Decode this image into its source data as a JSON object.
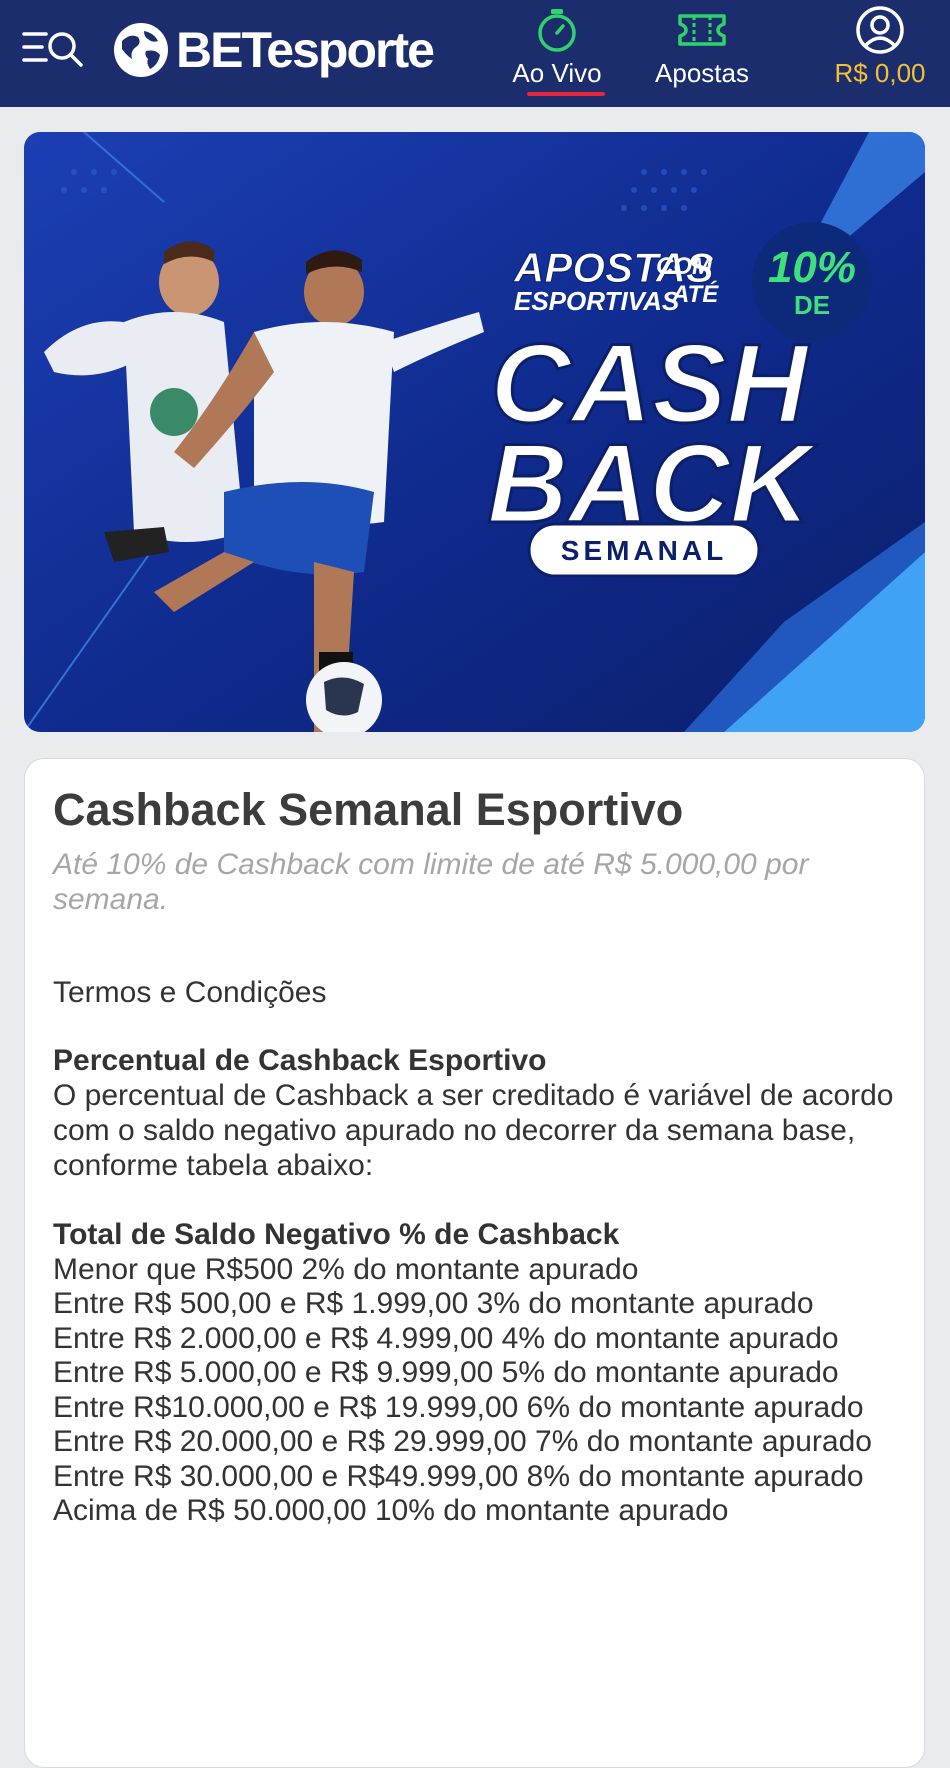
{
  "header": {
    "logo_text": "BETesporte",
    "nav": {
      "live_label": "Ao Vivo",
      "bets_label": "Apostas",
      "balance": "R$ 0,00"
    },
    "colors": {
      "bar": "#1c2d6e",
      "live_icon": "#2ed36b",
      "bets_icon": "#2ed36b",
      "active_underline": "#e8253d",
      "balance": "#f2c230"
    }
  },
  "banner": {
    "line1": "APOSTAS",
    "line2": "ESPORTIVAS",
    "com": "COM",
    "ate": "ATÉ",
    "percent": "10%",
    "de": "DE",
    "cash": "CASH",
    "back": "BACK",
    "semanal": "SEMANAL"
  },
  "promo": {
    "title": "Cashback Semanal Esportivo",
    "subtitle": "Até 10% de Cashback com limite de até R$ 5.000,00 por semana.",
    "terms_heading": "Termos e Condições",
    "section_title": "Percentual de Cashback Esportivo",
    "section_text": "O percentual de Cashback a ser creditado é variável de acordo com o saldo negativo apurado no decorrer da semana base, conforme tabela abaixo:",
    "table_header": "Total de Saldo Negativo % de Cashback",
    "table_rows": [
      "Menor que R$500 2% do montante apurado",
      "Entre R$ 500,00 e R$ 1.999,00 3% do montante apurado",
      "Entre R$ 2.000,00 e R$ 4.999,00 4% do montante apurado",
      "Entre R$ 5.000,00 e R$ 9.999,00 5% do montante apurado",
      "Entre R$10.000,00 e R$ 19.999,00 6% do montante apurado",
      "Entre R$ 20.000,00 e R$ 29.999,00 7% do montante apurado",
      "Entre R$ 30.000,00 e R$49.999,00 8% do montante apurado",
      "Acima de R$ 50.000,00 10% do montante apurado"
    ]
  }
}
